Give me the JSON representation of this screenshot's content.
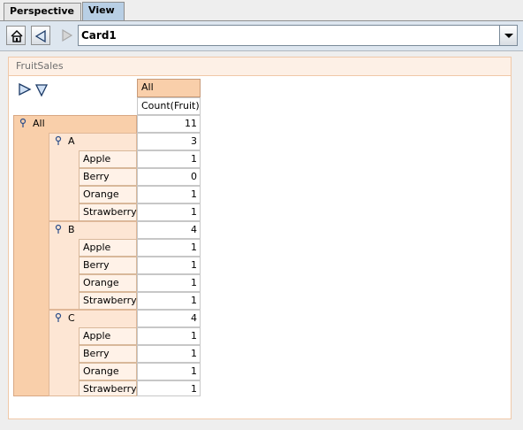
{
  "tabs": [
    {
      "label": "Perspective",
      "active": false
    },
    {
      "label": "View",
      "active": true
    }
  ],
  "toolbar": {
    "home_icon": "home-icon",
    "back_icon": "back-icon",
    "forward_icon": "forward-icon",
    "card": "Card1"
  },
  "panel": {
    "title": "FruitSales"
  },
  "pivot": {
    "column_header": "All",
    "measure_header": "Count(Fruit)",
    "total_label": "All",
    "total_value": "11",
    "groups": [
      {
        "label": "A",
        "total": "3",
        "items": [
          {
            "label": "Apple",
            "value": "1"
          },
          {
            "label": "Berry",
            "value": "0"
          },
          {
            "label": "Orange",
            "value": "1"
          },
          {
            "label": "Strawberry",
            "value": "1"
          }
        ]
      },
      {
        "label": "B",
        "total": "4",
        "items": [
          {
            "label": "Apple",
            "value": "1"
          },
          {
            "label": "Berry",
            "value": "1"
          },
          {
            "label": "Orange",
            "value": "1"
          },
          {
            "label": "Strawberry",
            "value": "1"
          }
        ]
      },
      {
        "label": "C",
        "total": "4",
        "items": [
          {
            "label": "Apple",
            "value": "1"
          },
          {
            "label": "Berry",
            "value": "1"
          },
          {
            "label": "Orange",
            "value": "1"
          },
          {
            "label": "Strawberry",
            "value": "1"
          }
        ]
      }
    ]
  },
  "colors": {
    "total_bg": "#f9cfaa",
    "group_bg": "#fde6d4",
    "item_bg": "#fff2e8",
    "header_bg": "#f9cfaa",
    "accent": "#b8cfe5"
  }
}
